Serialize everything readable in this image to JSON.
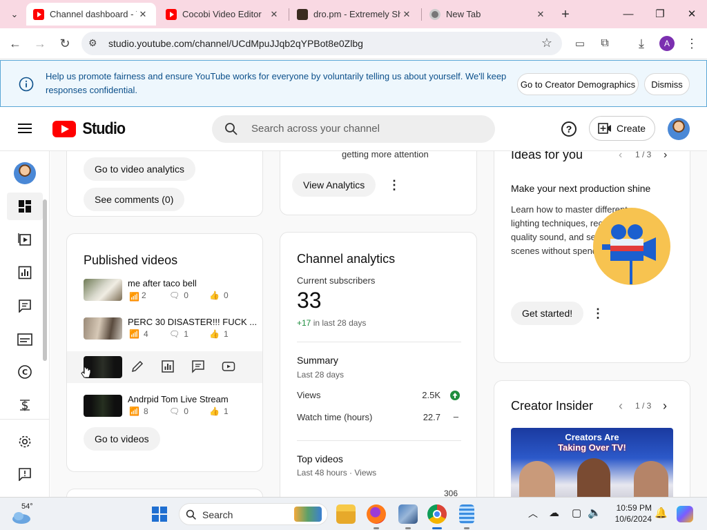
{
  "browser": {
    "tabs": [
      {
        "title": "Channel dashboard - YouTube Studio",
        "icon": "youtube-icon",
        "active": true
      },
      {
        "title": "Cocobi Video Editor",
        "icon": "youtube-icon",
        "active": false
      },
      {
        "title": "dro.pm - Extremely Short URLs",
        "icon": "dro-icon",
        "active": false
      },
      {
        "title": "New Tab",
        "icon": "chrome-icon",
        "active": false
      }
    ],
    "url": "studio.youtube.com/channel/UCdMpuJJqb2qYPBot8e0Zlbg",
    "profile_initial": "A"
  },
  "banner": {
    "text": "Help us promote fairness and ensure YouTube works for everyone by voluntarily telling us about yourself. We'll keep responses confidential.",
    "primary_label": "Go to Creator Demographics",
    "dismiss_label": "Dismiss"
  },
  "header": {
    "logo_text": "Studio",
    "search_placeholder": "Search across your channel",
    "create_label": "Create"
  },
  "latest_video_card": {
    "analytics_label": "Go to video analytics",
    "comments_label": "See comments (0)"
  },
  "insight_card": {
    "text": "getting more attention",
    "analytics_label": "View Analytics"
  },
  "published": {
    "title": "Published videos",
    "videos": [
      {
        "title": "me after taco bell",
        "views": "2",
        "comments": "0",
        "likes": "0"
      },
      {
        "title": "PERC 30 DISASTER!!! FUCK ...",
        "views": "4",
        "comments": "1",
        "likes": "1"
      },
      {
        "title": "",
        "views": "",
        "comments": "",
        "likes": ""
      },
      {
        "title": "Andrpid Tom Live Stream",
        "views": "8",
        "comments": "0",
        "likes": "1"
      }
    ],
    "goto_label": "Go to videos"
  },
  "analytics": {
    "title": "Channel analytics",
    "subs_label": "Current subscribers",
    "subs_value": "33",
    "subs_delta": "+17",
    "subs_delta_suffix": "in last 28 days",
    "summary_title": "Summary",
    "summary_period": "Last 28 days",
    "rows": [
      {
        "label": "Views",
        "value": "2.5K"
      },
      {
        "label": "Watch time (hours)",
        "value": "22.7"
      }
    ],
    "top_title": "Top videos",
    "top_period": "Last 48 hours · Views",
    "top_value": "306"
  },
  "ideas": {
    "title": "Ideas for you",
    "pager": "1 / 3",
    "headline": "Make your next production shine",
    "body": "Learn how to master different lighting techniques, record high quality sound, and set up your scenes without spending a fortune",
    "cta": "Get started!"
  },
  "insider": {
    "title": "Creator Insider",
    "pager": "1 / 3",
    "thumb_line1": "Creators Are",
    "thumb_line2": "Taking Over TV!"
  },
  "taskbar": {
    "weather": "54°",
    "search_label": "Search",
    "time": "10:59 PM",
    "date": "10/6/2024"
  },
  "colors": {
    "youtube_red": "#ff0000",
    "banner_bg": "#eef7fd",
    "banner_text": "#0b4f8a",
    "positive_green": "#1e8e3e"
  }
}
